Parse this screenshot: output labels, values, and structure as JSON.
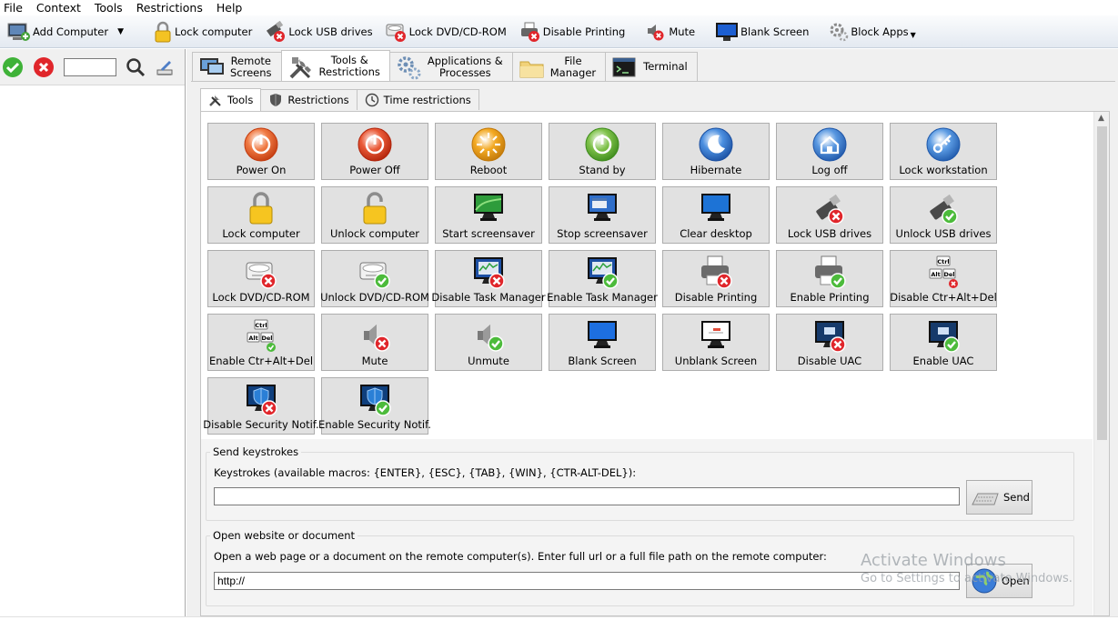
{
  "menu": [
    "File",
    "Context",
    "Tools",
    "Restrictions",
    "Help"
  ],
  "toolbar": {
    "add_computer": "Add Computer",
    "lock_computer": "Lock computer",
    "lock_usb": "Lock USB drives",
    "lock_dvd": "Lock DVD/CD-ROM",
    "disable_printing": "Disable Printing",
    "mute": "Mute",
    "blank_screen": "Blank Screen",
    "block_apps": "Block Apps"
  },
  "left_panel": {
    "search_value": "",
    "icons": [
      "check-icon",
      "cancel-icon",
      "search-icon",
      "edit-icon"
    ]
  },
  "main_tabs": [
    {
      "l1": "Remote",
      "l2": "Screens",
      "icon": "remote-screens-icon"
    },
    {
      "l1": "Tools &",
      "l2": "Restrictions",
      "icon": "tools-icon",
      "active": true
    },
    {
      "l1": "Applications &",
      "l2": "Processes",
      "icon": "gears-icon"
    },
    {
      "l1": "File",
      "l2": "Manager",
      "icon": "folder-icon"
    },
    {
      "l1": "Terminal",
      "l2": "",
      "icon": "terminal-icon"
    }
  ],
  "sub_tabs": [
    {
      "label": "Tools",
      "active": true
    },
    {
      "label": "Restrictions"
    },
    {
      "label": "Time restrictions"
    }
  ],
  "tools": [
    {
      "label": "Power On",
      "icon": "power-on-icon"
    },
    {
      "label": "Power Off",
      "icon": "power-off-icon"
    },
    {
      "label": "Reboot",
      "icon": "reboot-icon"
    },
    {
      "label": "Stand by",
      "icon": "standby-icon"
    },
    {
      "label": "Hibernate",
      "icon": "hibernate-icon"
    },
    {
      "label": "Log off",
      "icon": "log-off-icon"
    },
    {
      "label": "Lock workstation",
      "icon": "lock-workstation-icon"
    },
    {
      "label": "Lock computer",
      "icon": "padlock-closed-icon"
    },
    {
      "label": "Unlock computer",
      "icon": "padlock-open-icon"
    },
    {
      "label": "Start screensaver",
      "icon": "screensaver-icon"
    },
    {
      "label": "Stop screensaver",
      "icon": "stop-screensaver-icon"
    },
    {
      "label": "Clear desktop",
      "icon": "clear-desktop-icon"
    },
    {
      "label": "Lock USB drives",
      "icon": "usb-lock-icon"
    },
    {
      "label": "Unlock USB drives",
      "icon": "usb-unlock-icon"
    },
    {
      "label": "Lock DVD/CD-ROM",
      "icon": "dvd-lock-icon"
    },
    {
      "label": "Unlock DVD/CD-ROM",
      "icon": "dvd-unlock-icon"
    },
    {
      "label": "Disable Task Manager",
      "icon": "task-manager-disable-icon"
    },
    {
      "label": "Enable Task Manager",
      "icon": "task-manager-enable-icon"
    },
    {
      "label": "Disable Printing",
      "icon": "printer-disable-icon"
    },
    {
      "label": "Enable Printing",
      "icon": "printer-enable-icon"
    },
    {
      "label": "Disable Ctr+Alt+Del",
      "icon": "ctrl-alt-del-disable-icon"
    },
    {
      "label": "Enable Ctr+Alt+Del",
      "icon": "ctrl-alt-del-enable-icon"
    },
    {
      "label": "Mute",
      "icon": "speaker-mute-icon"
    },
    {
      "label": "Unmute",
      "icon": "speaker-unmute-icon"
    },
    {
      "label": "Blank Screen",
      "icon": "monitor-blank-icon"
    },
    {
      "label": "Unblank Screen",
      "icon": "monitor-unblank-icon"
    },
    {
      "label": "Disable UAC",
      "icon": "uac-disable-icon"
    },
    {
      "label": "Enable UAC",
      "icon": "uac-enable-icon"
    },
    {
      "label": "Disable Security Notif.",
      "icon": "shield-disable-icon"
    },
    {
      "label": "Enable Security Notif.",
      "icon": "shield-enable-icon"
    }
  ],
  "keystrokes": {
    "title": "Send keystrokes",
    "desc": "Keystrokes (available macros: {ENTER}, {ESC}, {TAB}, {WIN}, {CTR-ALT-DEL}):",
    "value": "",
    "button": "Send"
  },
  "website": {
    "title": "Open website or document",
    "desc": "Open a web page or a document on the remote computer(s). Enter full url or a full file path on the remote computer:",
    "value": "http://",
    "button": "Open"
  },
  "watermark": {
    "line1": "Activate Windows",
    "line2": "Go to Settings to activate Windows."
  },
  "colors": {
    "tile_bg": "#e1e1e1",
    "red_badge": "#e0262b",
    "green_badge": "#4cbb3b",
    "toolbar_bg": "#e8edf4"
  }
}
